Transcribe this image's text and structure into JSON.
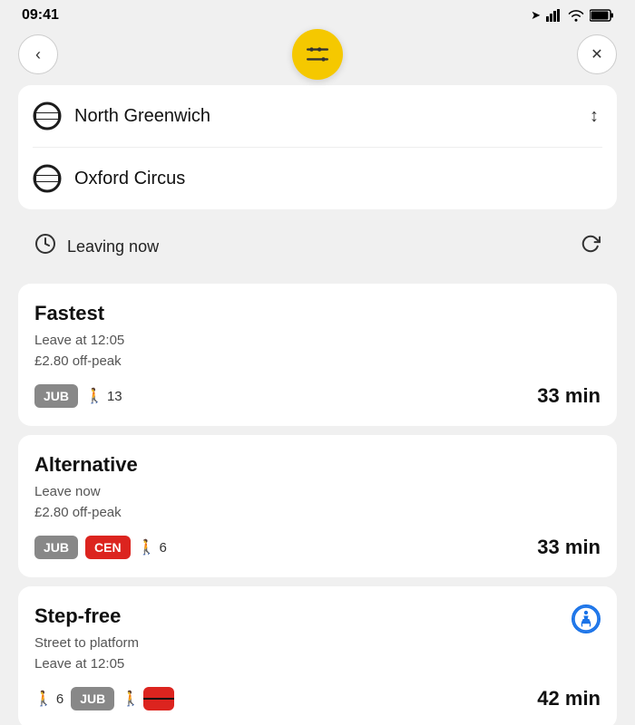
{
  "statusBar": {
    "time": "09:41",
    "hasLocation": true
  },
  "header": {
    "backLabel": "‹",
    "closeLabel": "✕",
    "filterIcon": "filter"
  },
  "route": {
    "from": "North Greenwich",
    "to": "Oxford Circus",
    "swapLabel": "swap"
  },
  "leaving": {
    "text": "Leaving now",
    "icon": "clock"
  },
  "journeys": [
    {
      "title": "Fastest",
      "detail1": "Leave at 12:05",
      "detail2": "£2.80 off-peak",
      "tags": [
        "JUB"
      ],
      "walk": "13",
      "time": "33 min"
    },
    {
      "title": "Alternative",
      "detail1": "Leave now",
      "detail2": "£2.80 off-peak",
      "tags": [
        "JUB",
        "CEN"
      ],
      "walk": "6",
      "time": "33 min"
    },
    {
      "title": "Step-free",
      "detail1": "Street to platform",
      "detail2": "Leave at 12:05",
      "tags": [
        "JUB"
      ],
      "walk": "6",
      "time": "42 min",
      "stepFree": true
    }
  ]
}
